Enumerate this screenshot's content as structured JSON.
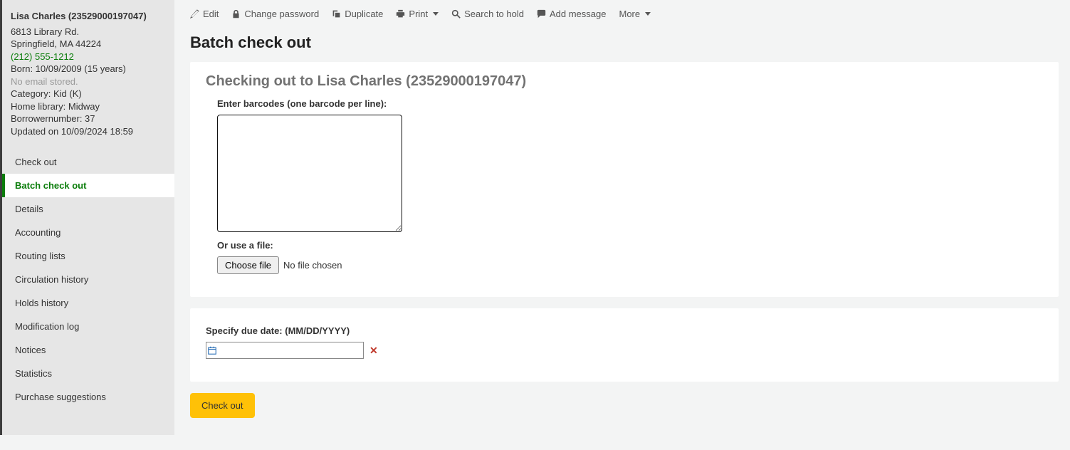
{
  "patron": {
    "name": "Lisa Charles (23529000197047)",
    "address_line1": "6813 Library Rd.",
    "address_line2": "Springfield, MA 44224",
    "phone": "(212) 555-1212",
    "born": "Born: 10/09/2009 (15 years)",
    "email": "No email stored.",
    "category": "Category: Kid (K)",
    "home_library": "Home library: Midway",
    "borrowernumber": "Borrowernumber: 37",
    "updated": "Updated on 10/09/2024 18:59"
  },
  "sidebar": {
    "items": [
      {
        "label": "Check out",
        "active": false
      },
      {
        "label": "Batch check out",
        "active": true
      },
      {
        "label": "Details",
        "active": false
      },
      {
        "label": "Accounting",
        "active": false
      },
      {
        "label": "Routing lists",
        "active": false
      },
      {
        "label": "Circulation history",
        "active": false
      },
      {
        "label": "Holds history",
        "active": false
      },
      {
        "label": "Modification log",
        "active": false
      },
      {
        "label": "Notices",
        "active": false
      },
      {
        "label": "Statistics",
        "active": false
      },
      {
        "label": "Purchase suggestions",
        "active": false
      }
    ]
  },
  "toolbar": {
    "edit": "Edit",
    "change_password": "Change password",
    "duplicate": "Duplicate",
    "print": "Print",
    "search_to_hold": "Search to hold",
    "add_message": "Add message",
    "more": "More"
  },
  "page": {
    "title": "Batch check out",
    "heading": "Checking out to Lisa Charles (23529000197047)",
    "barcodes_label": "Enter barcodes (one barcode per line):",
    "barcodes_value": "",
    "file_label": "Or use a file:",
    "choose_file": "Choose file",
    "file_status": "No file chosen",
    "due_label": "Specify due date: (MM/DD/YYYY)",
    "due_value": "",
    "submit": "Check out"
  }
}
